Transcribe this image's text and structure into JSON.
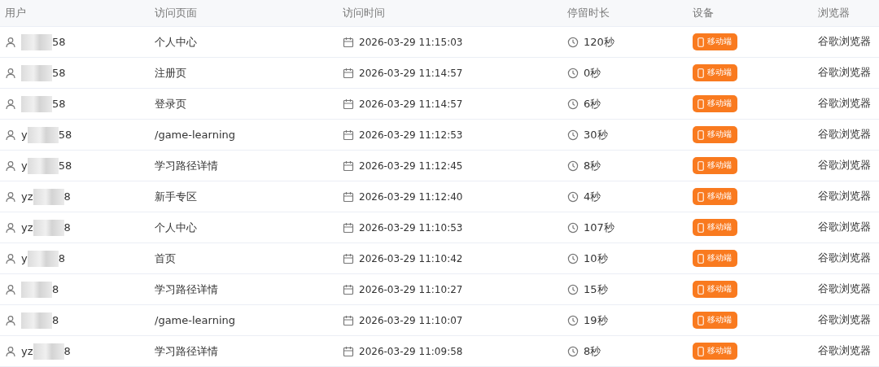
{
  "table": {
    "columns": [
      "用户",
      "访问页面",
      "访问时间",
      "停留时长",
      "设备",
      "浏览器"
    ],
    "rows": [
      {
        "user_start": "",
        "user_end": "58",
        "page": "个人中心",
        "time": "2026-03-29 11:15:03",
        "duration": "120秒",
        "device": "移动端",
        "browser": "谷歌浏览器"
      },
      {
        "user_start": "",
        "user_end": "58",
        "page": "注册页",
        "time": "2026-03-29 11:14:57",
        "duration": "0秒",
        "device": "移动端",
        "browser": "谷歌浏览器"
      },
      {
        "user_start": "",
        "user_end": "58",
        "page": "登录页",
        "time": "2026-03-29 11:14:57",
        "duration": "6秒",
        "device": "移动端",
        "browser": "谷歌浏览器"
      },
      {
        "user_start": "y",
        "user_end": "58",
        "page": "/game-learning",
        "time": "2026-03-29 11:12:53",
        "duration": "30秒",
        "device": "移动端",
        "browser": "谷歌浏览器"
      },
      {
        "user_start": "y",
        "user_end": "58",
        "page": "学习路径详情",
        "time": "2026-03-29 11:12:45",
        "duration": "8秒",
        "device": "移动端",
        "browser": "谷歌浏览器"
      },
      {
        "user_start": "yz",
        "user_end": "8",
        "page": "新手专区",
        "time": "2026-03-29 11:12:40",
        "duration": "4秒",
        "device": "移动端",
        "browser": "谷歌浏览器"
      },
      {
        "user_start": "yz",
        "user_end": "8",
        "page": "个人中心",
        "time": "2026-03-29 11:10:53",
        "duration": "107秒",
        "device": "移动端",
        "browser": "谷歌浏览器"
      },
      {
        "user_start": "y",
        "user_end": "8",
        "page": "首页",
        "time": "2026-03-29 11:10:42",
        "duration": "10秒",
        "device": "移动端",
        "browser": "谷歌浏览器"
      },
      {
        "user_start": "",
        "user_end": "8",
        "page": "学习路径详情",
        "time": "2026-03-29 11:10:27",
        "duration": "15秒",
        "device": "移动端",
        "browser": "谷歌浏览器"
      },
      {
        "user_start": "",
        "user_end": "8",
        "page": "/game-learning",
        "time": "2026-03-29 11:10:07",
        "duration": "19秒",
        "device": "移动端",
        "browser": "谷歌浏览器"
      },
      {
        "user_start": "yz",
        "user_end": "8",
        "page": "学习路径详情",
        "time": "2026-03-29 11:09:58",
        "duration": "8秒",
        "device": "移动端",
        "browser": "谷歌浏览器"
      }
    ]
  }
}
